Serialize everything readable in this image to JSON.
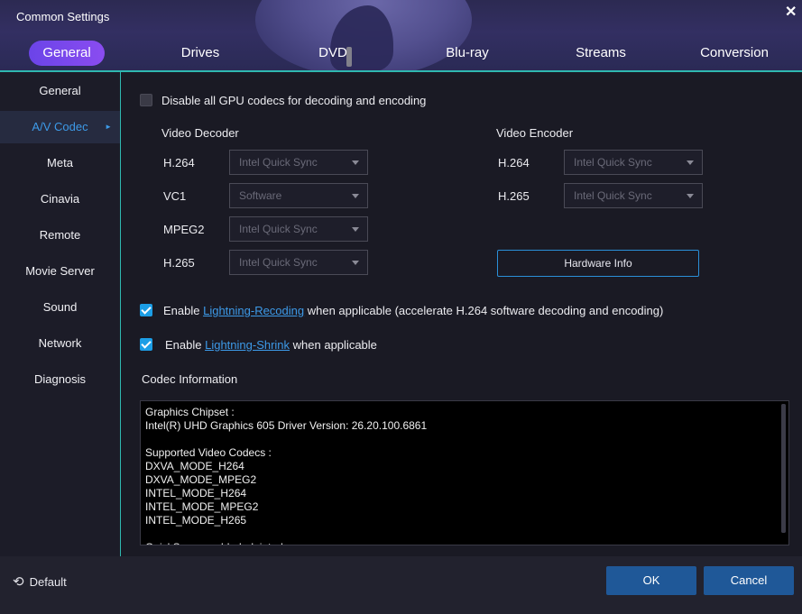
{
  "window": {
    "title": "Common Settings",
    "close_label": "✕"
  },
  "tabs": [
    {
      "label": "General",
      "active": true
    },
    {
      "label": "Drives",
      "active": false
    },
    {
      "label": "DVD",
      "active": false
    },
    {
      "label": "Blu-ray",
      "active": false
    },
    {
      "label": "Streams",
      "active": false
    },
    {
      "label": "Conversion",
      "active": false
    }
  ],
  "sidebar": {
    "items": [
      {
        "label": "General"
      },
      {
        "label": "A/V Codec",
        "active": true
      },
      {
        "label": "Meta"
      },
      {
        "label": "Cinavia"
      },
      {
        "label": "Remote"
      },
      {
        "label": "Movie Server"
      },
      {
        "label": "Sound"
      },
      {
        "label": "Network"
      },
      {
        "label": "Diagnosis"
      }
    ],
    "active_arrow": "►"
  },
  "main": {
    "disable_gpu": {
      "label": "Disable all GPU codecs for decoding and encoding",
      "checked": false
    },
    "decoder": {
      "heading": "Video Decoder",
      "rows": [
        {
          "label": "H.264",
          "value": "Intel Quick Sync"
        },
        {
          "label": "VC1",
          "value": "Software"
        },
        {
          "label": "MPEG2",
          "value": "Intel Quick Sync"
        },
        {
          "label": "H.265",
          "value": "Intel Quick Sync"
        }
      ]
    },
    "encoder": {
      "heading": "Video Encoder",
      "rows": [
        {
          "label": "H.264",
          "value": "Intel Quick Sync"
        },
        {
          "label": "H.265",
          "value": "Intel Quick Sync"
        }
      ]
    },
    "hardware_info_label": "Hardware Info",
    "lightning_recoding": {
      "prefix": "Enable ",
      "link": "Lightning-Recoding",
      "suffix": " when applicable (accelerate H.264 software decoding and encoding)",
      "checked": true
    },
    "lightning_shrink": {
      "prefix": "Enable ",
      "link": "Lightning-Shrink",
      "suffix": " when applicable",
      "checked": true
    },
    "codec_info": {
      "heading": "Codec Information",
      "text": "Graphics Chipset :\nIntel(R) UHD Graphics 605 Driver Version: 26.20.100.6861\n\nSupported Video Codecs :\nDXVA_MODE_H264\nDXVA_MODE_MPEG2\nINTEL_MODE_H264\nINTEL_MODE_MPEG2\nINTEL_MODE_H265\n\nQuickSync: enabled, deinterlace"
    }
  },
  "footer": {
    "default_label": "Default",
    "ok_label": "OK",
    "cancel_label": "Cancel"
  },
  "colors": {
    "accent_teal": "#2fb8b0",
    "tab_active": "#7a48ec",
    "link_blue": "#3d9ae8",
    "checkbox_blue": "#1c9ee6",
    "button_blue": "#1f5898"
  }
}
